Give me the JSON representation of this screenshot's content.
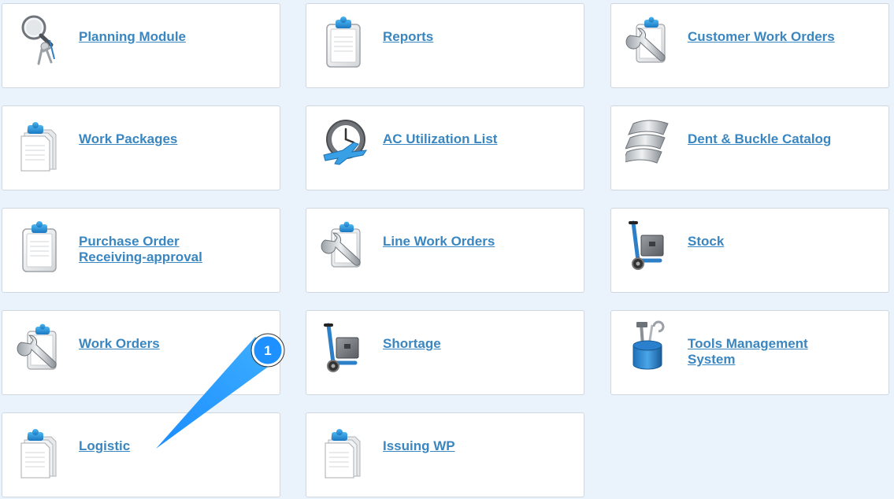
{
  "tiles": [
    {
      "id": "planning-module",
      "label": "Planning Module",
      "icon": "magnifier-figure-icon"
    },
    {
      "id": "reports",
      "label": "Reports",
      "icon": "clipboard-icon"
    },
    {
      "id": "customer-work-orders",
      "label": "Customer Work Orders",
      "icon": "clipboard-wrench-icon"
    },
    {
      "id": "work-packages",
      "label": "Work Packages",
      "icon": "clipboard-stack-icon"
    },
    {
      "id": "ac-utilization-list",
      "label": "AC Utilization List",
      "icon": "clock-airplane-icon"
    },
    {
      "id": "dent-buckle-catalog",
      "label": "Dent & Buckle Catalog",
      "icon": "metal-sheets-icon"
    },
    {
      "id": "purchase-order-receiving-approval",
      "label": "Purchase Order Receiving-approval",
      "icon": "clipboard-icon"
    },
    {
      "id": "line-work-orders",
      "label": "Line Work Orders",
      "icon": "clipboard-wrench-icon"
    },
    {
      "id": "stock",
      "label": "Stock",
      "icon": "hand-truck-icon"
    },
    {
      "id": "work-orders",
      "label": "Work Orders",
      "icon": "clipboard-wrench-icon"
    },
    {
      "id": "shortage",
      "label": "Shortage",
      "icon": "hand-truck-icon"
    },
    {
      "id": "tools-management-system",
      "label": "Tools Management System",
      "icon": "tool-bucket-icon"
    },
    {
      "id": "logistic",
      "label": "Logistic",
      "icon": "clipboard-stack-icon"
    },
    {
      "id": "issuing-wp",
      "label": "Issuing WP",
      "icon": "clipboard-stack-icon"
    }
  ],
  "callout": {
    "number": "1"
  },
  "colors": {
    "link": "#3a86c0",
    "accent": "#1e90ff",
    "background": "#eaf3fb"
  }
}
